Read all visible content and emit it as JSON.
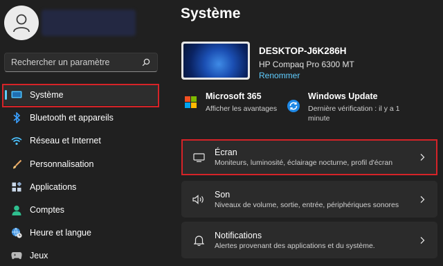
{
  "sidebar": {
    "search_placeholder": "Rechercher un paramètre",
    "items": [
      {
        "label": "Système",
        "icon": "display-icon",
        "selected": true
      },
      {
        "label": "Bluetooth et appareils",
        "icon": "bluetooth-icon"
      },
      {
        "label": "Réseau et Internet",
        "icon": "wifi-icon"
      },
      {
        "label": "Personnalisation",
        "icon": "brush-icon"
      },
      {
        "label": "Applications",
        "icon": "apps-icon"
      },
      {
        "label": "Comptes",
        "icon": "person-icon"
      },
      {
        "label": "Heure et langue",
        "icon": "clock-globe-icon"
      },
      {
        "label": "Jeux",
        "icon": "gamepad-icon"
      }
    ]
  },
  "main": {
    "title": "Système",
    "device": {
      "name": "DESKTOP-J6K286H",
      "model": "HP Compaq Pro 6300 MT",
      "rename_label": "Renommer"
    },
    "tiles": {
      "m365": {
        "title": "Microsoft 365",
        "subtitle": "Afficher les avantages"
      },
      "update": {
        "title": "Windows Update",
        "subtitle": "Dernière vérification : il y a 1 minute"
      }
    },
    "cards": [
      {
        "title": "Écran",
        "subtitle": "Moniteurs, luminosité, éclairage nocturne, profil d'écran",
        "icon": "monitor-icon"
      },
      {
        "title": "Son",
        "subtitle": "Niveaux de volume, sortie, entrée, périphériques sonores",
        "icon": "speaker-icon"
      },
      {
        "title": "Notifications",
        "subtitle": "Alertes provenant des applications et du système.",
        "icon": "bell-icon"
      }
    ]
  },
  "colors": {
    "background": "#202020",
    "card": "#2b2b2b",
    "accent": "#60cdff",
    "highlight_box": "#d62328"
  }
}
